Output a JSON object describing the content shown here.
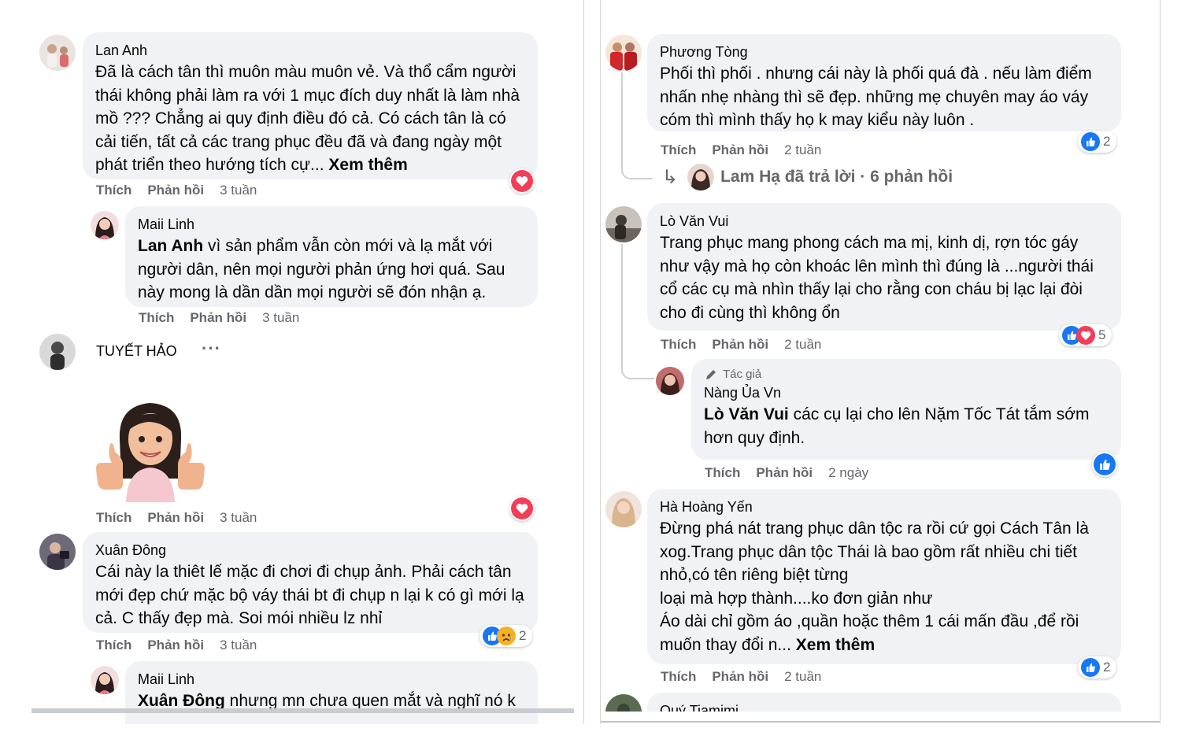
{
  "labels": {
    "like": "Thích",
    "reply": "Phản hồi",
    "see_more": "Xem thêm"
  },
  "left": {
    "c1": {
      "author": "Lan Anh",
      "text": "Đã là cách tân thì muôn màu muôn vẻ. Và thổ cẩm người thái không phải làm ra với 1 mục đích duy nhất là làm nhà mồ ??? Chẳng ai quy định điều đó cả. Có cách tân là có cải tiến, tất cả các trang phục đều đã và đang ngày một phát triển theo hướng tích cự...",
      "see_more": "Xem thêm",
      "time": "3 tuần",
      "reaction": "love"
    },
    "c1r1": {
      "author": "Maii Linh",
      "mention": "Lan Anh",
      "text": " vì sản phẩm vẫn còn mới và lạ mắt với người dân, nên mọi người phản ứng hơi quá. Sau này mong là dần dần mọi người sẽ đón nhận ạ.",
      "time": "3 tuần"
    },
    "c2": {
      "author": "TUYẾT HẢO",
      "more": "···",
      "time": "3 tuần",
      "reaction": "love",
      "sticker": "thumbs-up-avatar-sticker"
    },
    "c3": {
      "author": "Xuân Đông",
      "text": "Cái này la thiêt lế mặc đi chơi đi chụp ảnh. Phải cách tân mới đẹp chứ mặc bộ váy thái bt đi chụp n lại k có gì mới lạ cả. C thấy đẹp mà. Soi mói nhiều lz nhỉ",
      "time": "3 tuần",
      "reaction_count": "2"
    },
    "c3r1": {
      "author": "Maii Linh",
      "mention": "Xuân Đông",
      "text": " nhưng mn chưa quen mắt và nghĩ nó k"
    }
  },
  "right": {
    "c1": {
      "author": "Phương Tòng",
      "text": "Phối thì phối . nhưng cái này là phối quá đà . nếu làm điểm nhấn nhẹ nhàng thì sẽ đẹp. những mẹ chuyên may áo váy cóm thì mình thấy họ k may kiểu này luôn .",
      "time": "2 tuần",
      "reaction_count": "2",
      "reply_summary": "Lam Hạ đã trả lời · 6 phản hồi"
    },
    "c2": {
      "author": "Lò Văn Vui",
      "text": "Trang phục mang phong cách ma mị, kinh dị, rợn tóc gáy như vậy mà họ còn khoác lên mình thì đúng là ...người thái cổ các cụ mà nhìn thấy lại cho rằng con cháu bị lạc lại đòi cho đi cùng thì không ổn",
      "time": "2 tuần",
      "reaction_count": "5"
    },
    "c2r1": {
      "tag": "Tác giả",
      "author": "Nàng Ủa Vn",
      "mention": "Lò Văn Vui",
      "text": " các cụ lại cho lên Nặm Tốc Tát tắm sớm hơn quy định.",
      "time": "2 ngày"
    },
    "c3": {
      "author": "Hà Hoàng Yến",
      "text_lines": [
        "Đừng phá nát trang phục dân tộc ra rồi cứ gọi Cách Tân là xog.Trang phục dân tộc Thái là bao gồm rất nhiều chi tiết nhỏ,có tên riêng biệt từng",
        "loại mà hợp thành....ko đơn giản như",
        "Áo dài chỉ gồm áo ,quần hoặc thêm 1 cái mấn đầu ,để rồi muốn thay đổi n..."
      ],
      "see_more": "Xem thêm",
      "time": "2 tuần",
      "reaction_count": "2"
    },
    "c4": {
      "author": "Quý Tiamimi"
    }
  }
}
